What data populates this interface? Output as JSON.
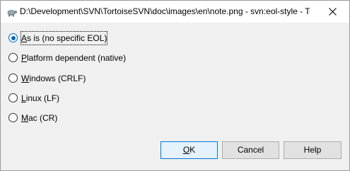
{
  "window": {
    "title": "D:\\Development\\SVN\\TortoiseSVN\\doc\\images\\en\\note.png - svn:eol-style - To...",
    "app_icon": "tortoise-icon",
    "close_icon": "close-icon"
  },
  "options": [
    {
      "prefix": "",
      "mnemonic": "A",
      "suffix": "s is (no specific EOL)",
      "checked": true
    },
    {
      "prefix": "",
      "mnemonic": "P",
      "suffix": "latform dependent (native)",
      "checked": false
    },
    {
      "prefix": "",
      "mnemonic": "W",
      "suffix": "indows (CRLF)",
      "checked": false
    },
    {
      "prefix": "",
      "mnemonic": "L",
      "suffix": "inux (LF)",
      "checked": false
    },
    {
      "prefix": "",
      "mnemonic": "M",
      "suffix": "ac (CR)",
      "checked": false
    }
  ],
  "buttons": {
    "ok_mnemonic": "O",
    "ok_rest": "K",
    "cancel": "Cancel",
    "help": "Help"
  },
  "colors": {
    "accent": "#0067c0",
    "default_button_border": "#0078d7",
    "button_face": "#e1e1e1",
    "dialog_background": "#f0f0f0"
  }
}
